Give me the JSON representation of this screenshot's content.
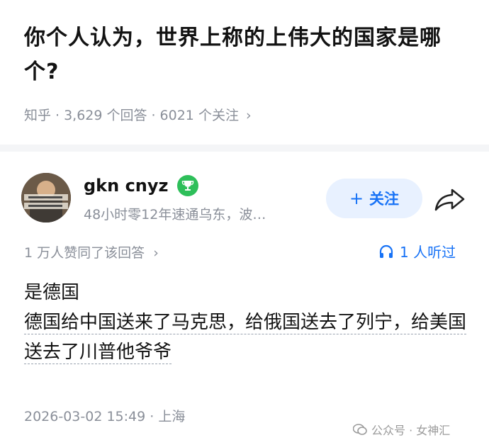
{
  "question": {
    "title": "你个人认为，世界上称的上伟大的国家是哪个?",
    "source": "知乎",
    "answer_count": "3,629 个回答",
    "follower_count": "6021 个关注",
    "chevron": "›"
  },
  "author": {
    "name": "gkn cnyz",
    "bio": "48小时零12年速通乌东，波…",
    "follow_label": "关注",
    "follow_plus": "+",
    "avatar_icon": "avatar-photo",
    "badge_icon": "trophy-badge-icon",
    "share_icon": "share-arrow-icon"
  },
  "stats": {
    "likes": "1 万人赞同了该回答",
    "likes_chevron": "›",
    "listen": "1 人听过",
    "listen_icon": "headphones-icon"
  },
  "answer": {
    "line1": "是德国",
    "line2": "德国给中国送来了马克思，给俄国送去了列宁，给美国送去了川普他爷爷"
  },
  "timestamp": "2026-03-02 15:49 · 上海",
  "watermark": "公众号 · 女神汇",
  "colors": {
    "accent": "#1772f6",
    "follow_bg": "#e8f1ff",
    "meta": "#8a8f99",
    "badge": "#2ebf5a",
    "divider": "#f4f5f7"
  }
}
